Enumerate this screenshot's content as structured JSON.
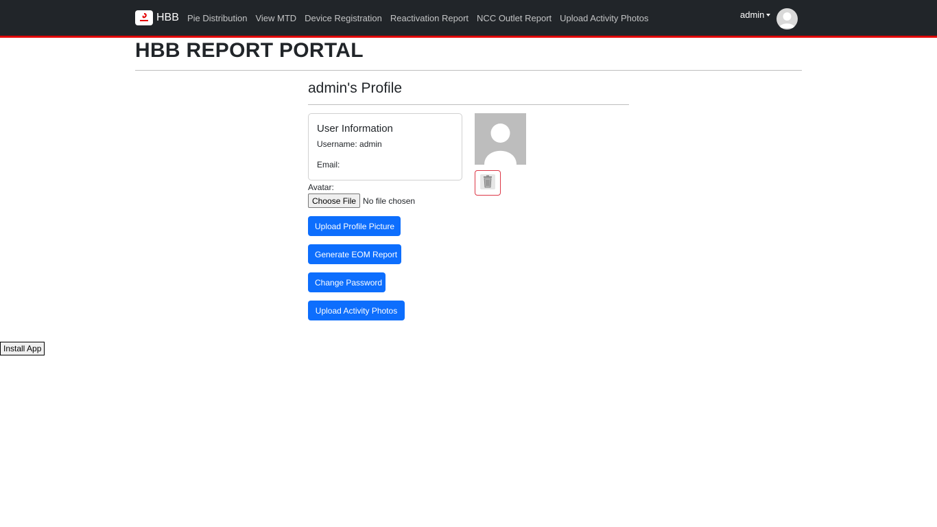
{
  "navbar": {
    "brand": "HBB",
    "links": [
      "Pie Distribution",
      "View MTD",
      "Device Registration",
      "Reactivation Report",
      "NCC Outlet Report",
      "Upload Activity Photos"
    ],
    "user": "admin",
    "accent_color": "#e00000",
    "background": "#212529"
  },
  "page": {
    "title": "HBB REPORT PORTAL"
  },
  "profile": {
    "title": "admin's Profile",
    "card_title": "User Information",
    "username": "Username: admin",
    "email": "Email:",
    "avatar_label": "Avatar:",
    "file_button": "Choose File",
    "file_status": "No file chosen",
    "buttons": {
      "upload_picture": "Upload Profile Picture",
      "generate_eom": "Generate EOM Report",
      "change_password": "Change Password",
      "upload_photos": "Upload Activity Photos"
    },
    "primary_color": "#0d6efd",
    "danger_color": "#dc3545"
  },
  "install": {
    "label": "Install App"
  }
}
